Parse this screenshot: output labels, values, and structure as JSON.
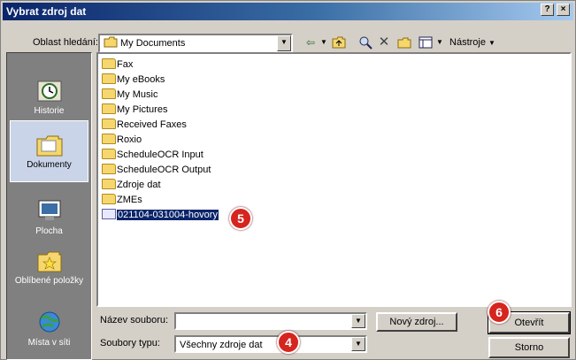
{
  "window": {
    "title": "Vybrat zdroj dat",
    "help_btn": "?",
    "close_btn": "×"
  },
  "lookin": {
    "label": "Oblast hledání:",
    "value": "My Documents"
  },
  "toolbar": {
    "tools_label": "Nástroje"
  },
  "places": [
    {
      "label": "Historie",
      "icon": "history-icon"
    },
    {
      "label": "Dokumenty",
      "icon": "documents-icon"
    },
    {
      "label": "Plocha",
      "icon": "desktop-icon"
    },
    {
      "label": "Oblíbené položky",
      "icon": "favorites-icon"
    },
    {
      "label": "Místa v síti",
      "icon": "network-places-icon"
    }
  ],
  "files": [
    {
      "name": "Fax",
      "type": "folder"
    },
    {
      "name": "My eBooks",
      "type": "folder"
    },
    {
      "name": "My Music",
      "type": "folder"
    },
    {
      "name": "My Pictures",
      "type": "folder"
    },
    {
      "name": "Received Faxes",
      "type": "folder"
    },
    {
      "name": "Roxio",
      "type": "folder"
    },
    {
      "name": "ScheduleOCR Input",
      "type": "folder"
    },
    {
      "name": "ScheduleOCR Output",
      "type": "folder"
    },
    {
      "name": "Zdroje dat",
      "type": "folder"
    },
    {
      "name": "ZMEs",
      "type": "folder"
    },
    {
      "name": "021104-031004-hovory",
      "type": "file",
      "selected": true
    }
  ],
  "filename": {
    "label": "Název souboru:",
    "value": ""
  },
  "filetype": {
    "label": "Soubory typu:",
    "value": "Všechny zdroje dat"
  },
  "buttons": {
    "new_source": "Nový zdroj...",
    "open": "Otevřít",
    "cancel": "Storno"
  },
  "badges": [
    "5",
    "4",
    "6"
  ]
}
